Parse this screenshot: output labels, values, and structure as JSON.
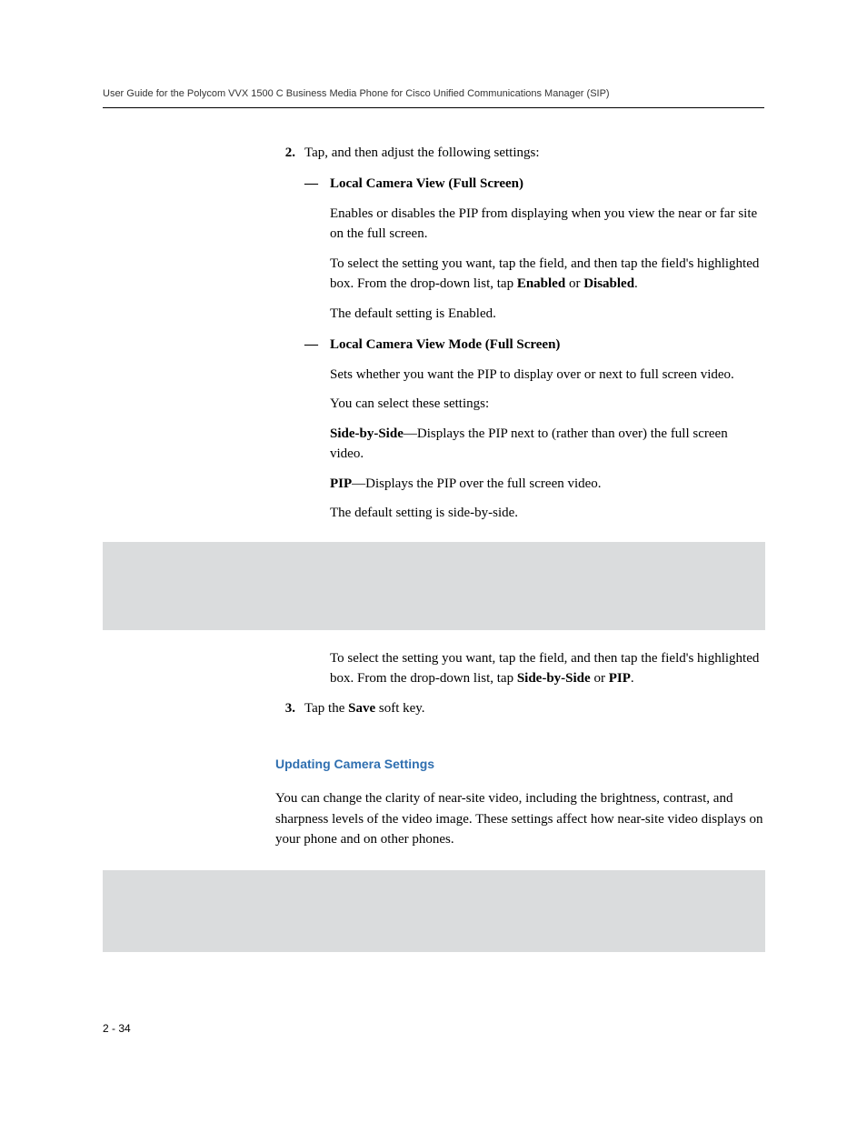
{
  "header": {
    "title": "User Guide for the Polycom VVX 1500 C Business Media Phone for Cisco Unified Communications Manager (SIP)"
  },
  "step2": {
    "number": "2.",
    "intro": "Tap, and then adjust the following settings:",
    "bullet1": {
      "title": "Local Camera View (Full Screen)",
      "p1": "Enables or disables the PIP from displaying when you view the near or far site on the full screen.",
      "p2a": "To select the setting you want, tap the field, and then tap the field's highlighted box. From the drop-down list, tap ",
      "p2_enabled": "Enabled",
      "p2_or": " or ",
      "p2_disabled": "Disabled",
      "p2_end": ".",
      "p3": "The default setting is Enabled."
    },
    "bullet2": {
      "title": "Local Camera View Mode (Full Screen)",
      "p1": "Sets whether you want the PIP to display over or next to full screen video.",
      "p2": "You can select these settings:",
      "p3_bold": "Side-by-Side",
      "p3_text": "—Displays the PIP next to (rather than over) the full screen video.",
      "p4_bold": "PIP",
      "p4_text": "—Displays the PIP over the full screen video.",
      "p5": "The default setting is side-by-side.",
      "p6a": "To select the setting you want, tap the field, and then tap the field's highlighted box. From the drop-down list, tap ",
      "p6_sbs": "Side-by-Side",
      "p6_or": " or ",
      "p6_pip": "PIP",
      "p6_end": "."
    }
  },
  "step3": {
    "number": "3.",
    "text_a": "Tap the ",
    "text_bold": "Save",
    "text_b": " soft key."
  },
  "section": {
    "heading": "Updating Camera Settings",
    "p1": "You can change the clarity of near-site video, including the brightness, contrast, and sharpness levels of the video image. These settings affect how near-site video displays on your phone and on other phones."
  },
  "footer": {
    "page": "2 - 34"
  }
}
